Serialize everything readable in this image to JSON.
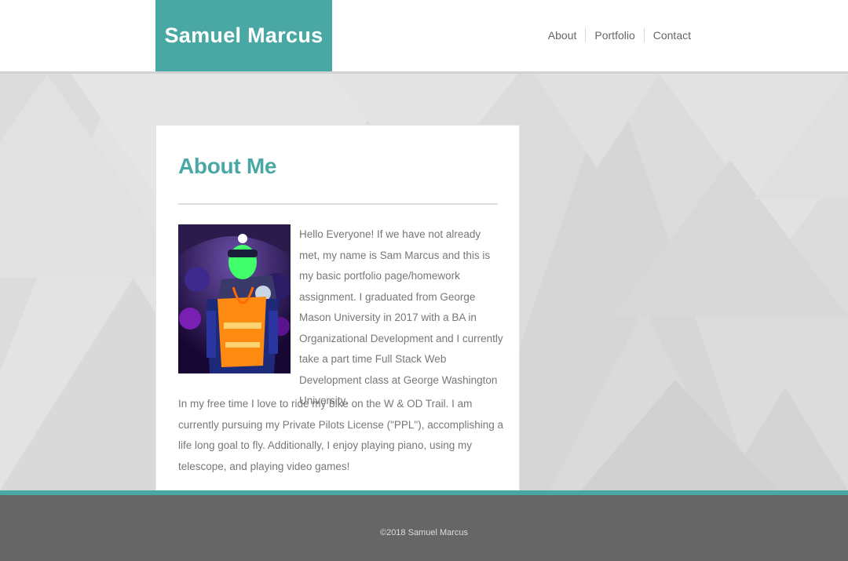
{
  "header": {
    "brand": "Samuel Marcus",
    "nav": [
      "About",
      "Portfolio",
      "Contact"
    ]
  },
  "about": {
    "title": "About Me",
    "intro": "Hello Everyone! If we have not already met, my name is Sam Marcus and this is my basic portfolio page/homework assignment. I graduated from George Mason University in 2017 with a BA in Organizational Development and I currently take a part time Full Stack Web Development class at George Washington University.",
    "hobbies": "In my free time I love to ride my bike on the W & OD Trail. I am currently pursuing my Private Pilots License (\"PPL\"), accomplishing a life long goal to fly. Additionally, I enjoy playing piano, using my telescope, and playing video games!"
  },
  "footer": {
    "copyright": "©2018 Samuel Marcus"
  },
  "colors": {
    "accent": "#4aa8a4",
    "footer_bg": "#666666",
    "text": "#777777"
  }
}
